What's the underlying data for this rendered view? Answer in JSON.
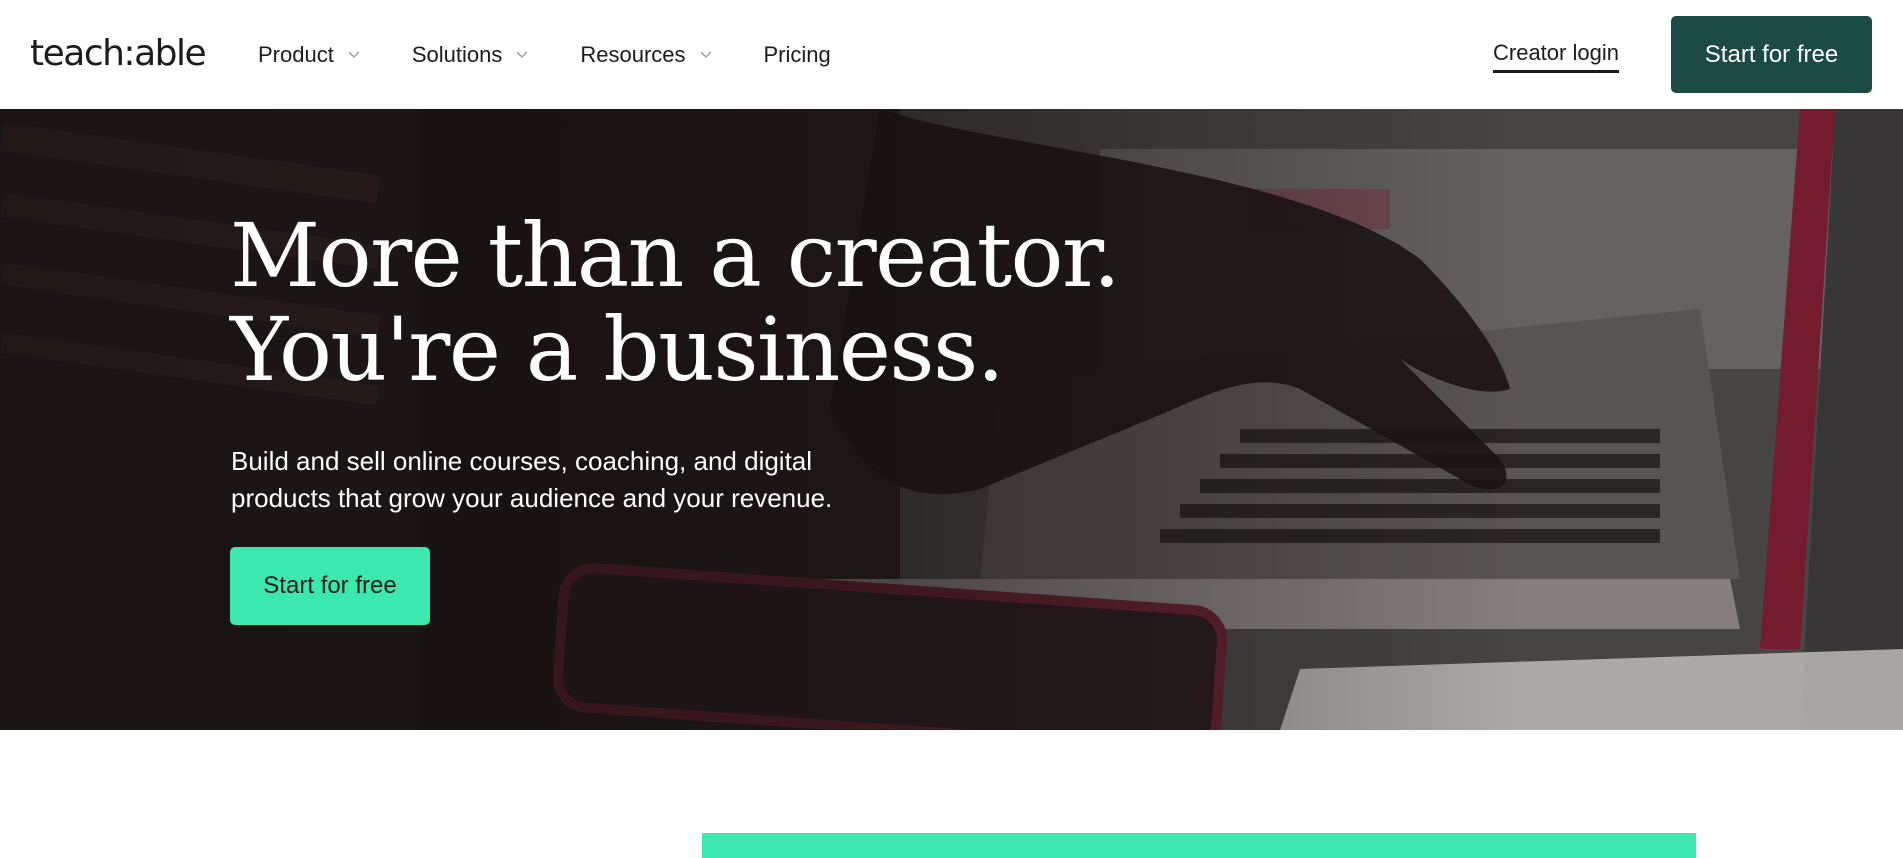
{
  "brand": {
    "logo": "teach:able"
  },
  "nav": {
    "items": [
      {
        "label": "Product",
        "has_dropdown": true
      },
      {
        "label": "Solutions",
        "has_dropdown": true
      },
      {
        "label": "Resources",
        "has_dropdown": true
      },
      {
        "label": "Pricing",
        "has_dropdown": false
      }
    ],
    "login_label": "Creator login",
    "cta_label": "Start for free"
  },
  "hero": {
    "headline_line1": "More than a creator.",
    "headline_line2": "You're a business.",
    "subtext_line1": "Build and sell online courses, coaching, and digital",
    "subtext_line2": "products that grow your audience and your revenue.",
    "cta_label": "Start for free"
  },
  "colors": {
    "primary_dark_green": "#1c4b43",
    "accent_mint": "#3be8b0",
    "text_dark": "#1c1c1c",
    "hero_text": "#ffffff"
  },
  "icons": {
    "dropdown": "chevron-down-icon"
  }
}
